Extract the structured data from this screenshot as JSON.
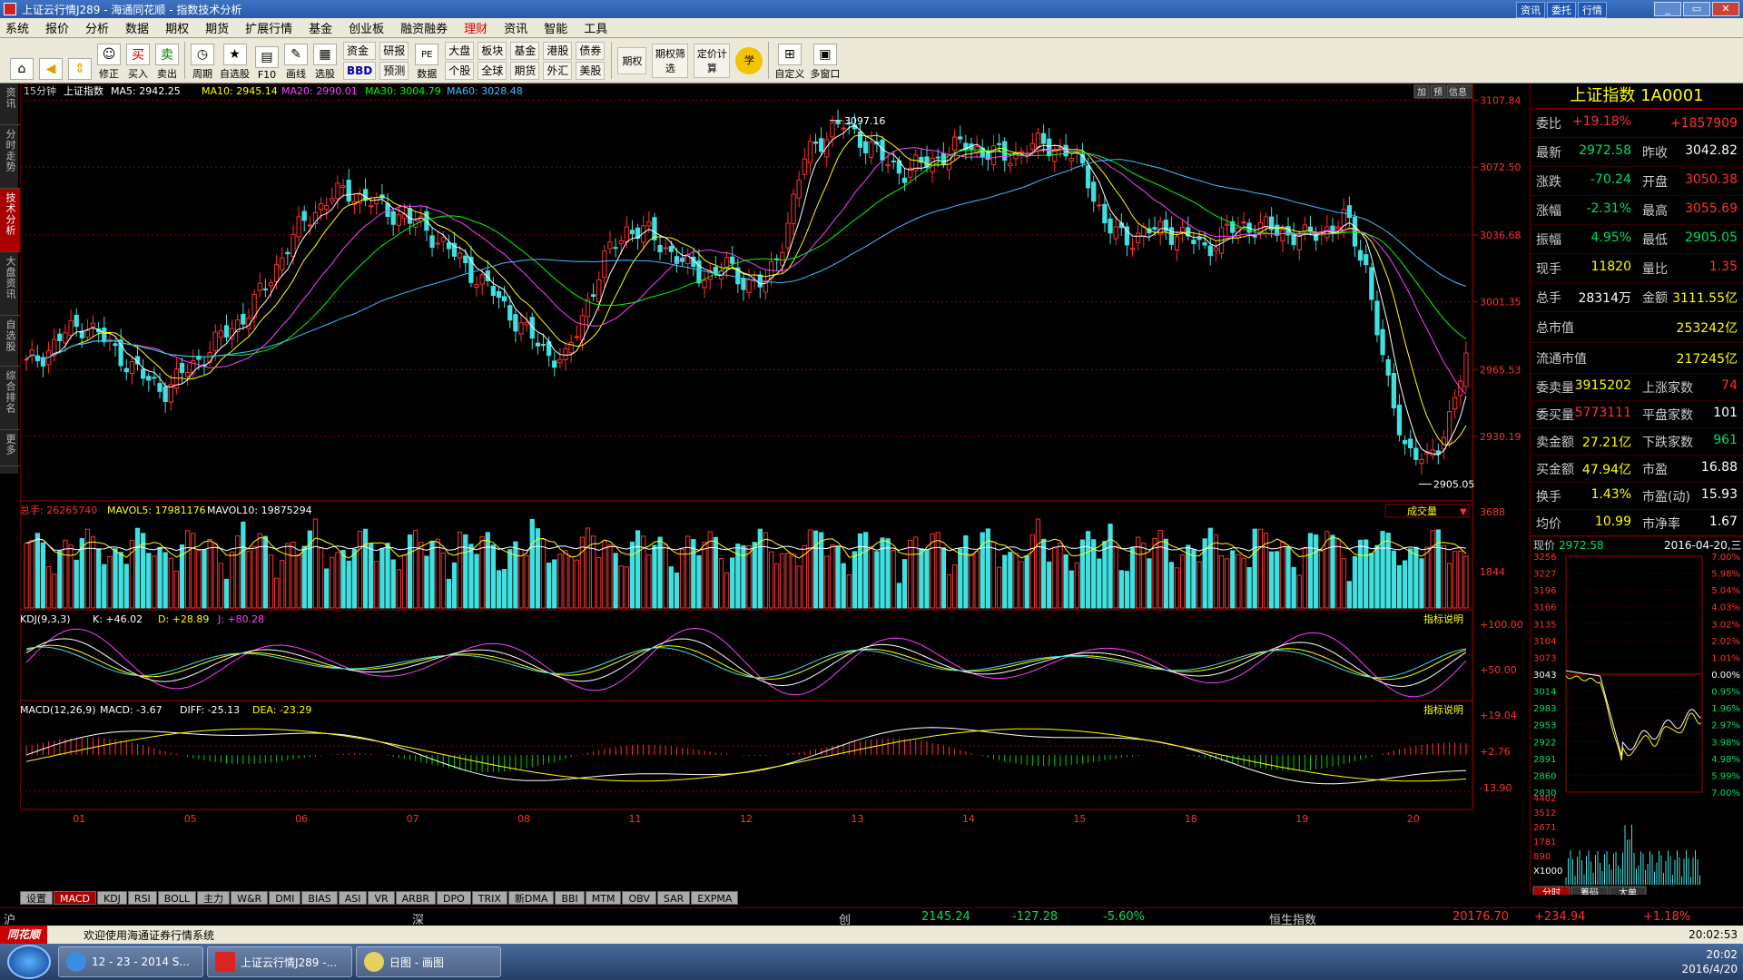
{
  "window": {
    "title": "上证云行情J289 - 海通同花顺 - 指数技术分析",
    "right_links": [
      "资讯",
      "委托",
      "行情"
    ]
  },
  "menu": [
    "系统",
    "报价",
    "分析",
    "数据",
    "期权",
    "期货",
    "扩展行情",
    "基金",
    "创业板",
    "融资融券",
    "理财",
    "资讯",
    "智能",
    "工具"
  ],
  "toolbar": {
    "buttons": [
      "修正",
      "买入",
      "卖出",
      "周期",
      "自选股",
      "F10",
      "画线",
      "选股"
    ],
    "grid1": [
      "资金",
      "研报",
      "BBD",
      "预测"
    ],
    "btn2": "数据",
    "grid2": [
      "大盘",
      "板块",
      "基金",
      "港股",
      "债券",
      "个股",
      "全球",
      "期货",
      "外汇",
      "美股"
    ],
    "buttons2": [
      "期权",
      "期权筛选",
      "定价计算",
      "学"
    ],
    "buttons3": [
      "自定义",
      "多窗口"
    ]
  },
  "left_tabs": [
    "资讯",
    "分时走势",
    "技术分析",
    "大盘资讯",
    "自选股",
    "综合排名",
    "更多"
  ],
  "chart_header": {
    "period": "15分钟",
    "name": "上证指数",
    "ma5": "MA5: 2942.25",
    "ma10": "MA10: 2945.14",
    "ma20": "MA20: 2990.01",
    "ma30": "MA30: 3004.79",
    "ma60": "MA60: 3028.48",
    "right_btns": [
      "加",
      "预",
      "信息"
    ]
  },
  "chart_data": [
    {
      "type": "candlestick",
      "title": "上证指数",
      "y_ticks": [
        "3107.84",
        "3072.50",
        "3036.68",
        "3001.35",
        "2965.53",
        "2930.19"
      ],
      "ylim": [
        2900,
        3110
      ],
      "annotations": [
        "3097.16",
        "2905.05"
      ],
      "x_ticks": [
        "01",
        "05",
        "06",
        "07",
        "08",
        "11",
        "12",
        "13",
        "14",
        "15",
        "18",
        "19",
        "20"
      ],
      "close_path": [
        2968,
        2975,
        2985,
        2990,
        2980,
        2970,
        2960,
        2955,
        2965,
        2975,
        2985,
        2995,
        3010,
        3030,
        3045,
        3055,
        3060,
        3055,
        3050,
        3045,
        3040,
        3030,
        3020,
        3010,
        2998,
        2985,
        2975,
        2970,
        3000,
        3025,
        3040,
        3038,
        3030,
        3020,
        3015,
        3020,
        3012,
        3010,
        3040,
        3080,
        3090,
        3095,
        3085,
        3075,
        3070,
        3075,
        3080,
        3085,
        3080,
        3078,
        3082,
        3085,
        3080,
        3070,
        3040,
        3035,
        3038,
        3040,
        3035,
        3030,
        3038,
        3042,
        3040,
        3038,
        3035,
        3040,
        3045,
        3020,
        2960,
        2925,
        2915,
        2935,
        2970
      ]
    },
    {
      "type": "bar",
      "title": "总手",
      "ylabel_ticks": [
        "3688",
        "1844"
      ],
      "header": {
        "vol": "总手: 26265740",
        "mavol5": "MAVOL5: 17981176",
        "mavol10": "MAVOL10: 19875294",
        "btn": "成交量"
      }
    },
    {
      "type": "line",
      "title": "KDJ(9,3,3)",
      "header": {
        "k": "K: +46.02",
        "d": "D: +28.89",
        "j": "J: +80.28",
        "btn": "指标说明"
      },
      "y_ticks": [
        "+100.00",
        "+50.00"
      ]
    },
    {
      "type": "bar",
      "title": "MACD(12,26,9)",
      "header": {
        "macd": "MACD: -3.67",
        "diff": "DIFF: -25.13",
        "dea": "DEA: -23.29",
        "btn": "指标说明"
      },
      "y_ticks": [
        "+19.04",
        "+2.76",
        "-13.90"
      ]
    }
  ],
  "bottom_tabs": [
    "设置",
    "MACD",
    "KDJ",
    "RSI",
    "BOLL",
    "主力",
    "W&R",
    "DMI",
    "BIAS",
    "ASI",
    "VR",
    "ARBR",
    "DPO",
    "TRIX",
    "新DMA",
    "BBI",
    "MTM",
    "OBV",
    "SAR",
    "EXPMA"
  ],
  "right_panel": {
    "title": "上证指数 1A0001",
    "rows": [
      [
        [
          "委比",
          "+19.18%",
          "red"
        ],
        [
          "",
          "+1857909",
          "red"
        ]
      ],
      [
        [
          "最新",
          "2972.58",
          "grn"
        ],
        [
          "昨收",
          "3042.82",
          "wht"
        ]
      ],
      [
        [
          "涨跌",
          "-70.24",
          "grn"
        ],
        [
          "开盘",
          "3050.38",
          "red"
        ]
      ],
      [
        [
          "涨幅",
          "-2.31%",
          "grn"
        ],
        [
          "最高",
          "3055.69",
          "red"
        ]
      ],
      [
        [
          "振幅",
          "4.95%",
          "grn"
        ],
        [
          "最低",
          "2905.05",
          "grn"
        ]
      ],
      [
        [
          "现手",
          "11820",
          "yel"
        ],
        [
          "量比",
          "1.35",
          "red"
        ]
      ],
      [
        [
          "总手",
          "28314万",
          "wht"
        ],
        [
          "金额",
          "3111.55亿",
          "yel"
        ]
      ]
    ],
    "rows2": [
      [
        [
          "总市值",
          "253242亿",
          "yel"
        ]
      ],
      [
        [
          "流通市值",
          "217245亿",
          "yel"
        ]
      ]
    ],
    "rows3": [
      [
        [
          "委卖量",
          "3915202",
          "yel"
        ],
        [
          "上涨家数",
          "74",
          "red"
        ]
      ],
      [
        [
          "委买量",
          "5773111",
          "red"
        ],
        [
          "平盘家数",
          "101",
          "wht"
        ]
      ],
      [
        [
          "卖金额",
          "27.21亿",
          "yel"
        ],
        [
          "下跌家数",
          "961",
          "grn"
        ]
      ],
      [
        [
          "买金额",
          "47.94亿",
          "yel"
        ],
        [
          "市盈",
          "16.88",
          "wht"
        ]
      ],
      [
        [
          "换手",
          "1.43%",
          "yel"
        ],
        [
          "市盈(动)",
          "15.93",
          "wht"
        ]
      ],
      [
        [
          "均价",
          "10.99",
          "yel"
        ],
        [
          "市净率",
          "1.67",
          "wht"
        ]
      ]
    ],
    "mini": {
      "label": "现价",
      "price": "2972.58",
      "date": "2016-04-20,三",
      "left_ticks": [
        "3256",
        "3227",
        "3196",
        "3166",
        "3135",
        "3104",
        "3073",
        "3043",
        "3014",
        "2983",
        "2953",
        "2922",
        "2891",
        "2860",
        "2830"
      ],
      "right_ticks": [
        "7.00%",
        "5.98%",
        "5.04%",
        "4.03%",
        "3.02%",
        "2.02%",
        "1.01%",
        "0.00%",
        "0.95%",
        "1.96%",
        "2.97%",
        "3.98%",
        "4.98%",
        "5.99%",
        "7.00%"
      ],
      "vol_ticks": [
        "4402",
        "3512",
        "2671",
        "1781",
        "890",
        "X1000"
      ],
      "tabs": [
        "分时",
        "筹码",
        "大单"
      ]
    }
  },
  "ticker": {
    "sh": "沪",
    "sz": "深",
    "cy": "创",
    "cy_val": "2145.24",
    "cy_chg": "-127.28",
    "cy_pct": "-5.60%",
    "hs": "恒生指数",
    "hs_val": "20176.70",
    "hs_chg": "+234.94",
    "hs_pct": "+1.18%",
    "time": "20:02:53"
  },
  "status": {
    "logo": "同花顺",
    "msg": "欢迎使用海通证券行情系统"
  },
  "taskbar": {
    "items": [
      "12 - 23 - 2014 S...",
      "上证云行情J289 -...",
      "日图 - 画图"
    ],
    "time": "20:02",
    "date": "2016/4/20"
  }
}
